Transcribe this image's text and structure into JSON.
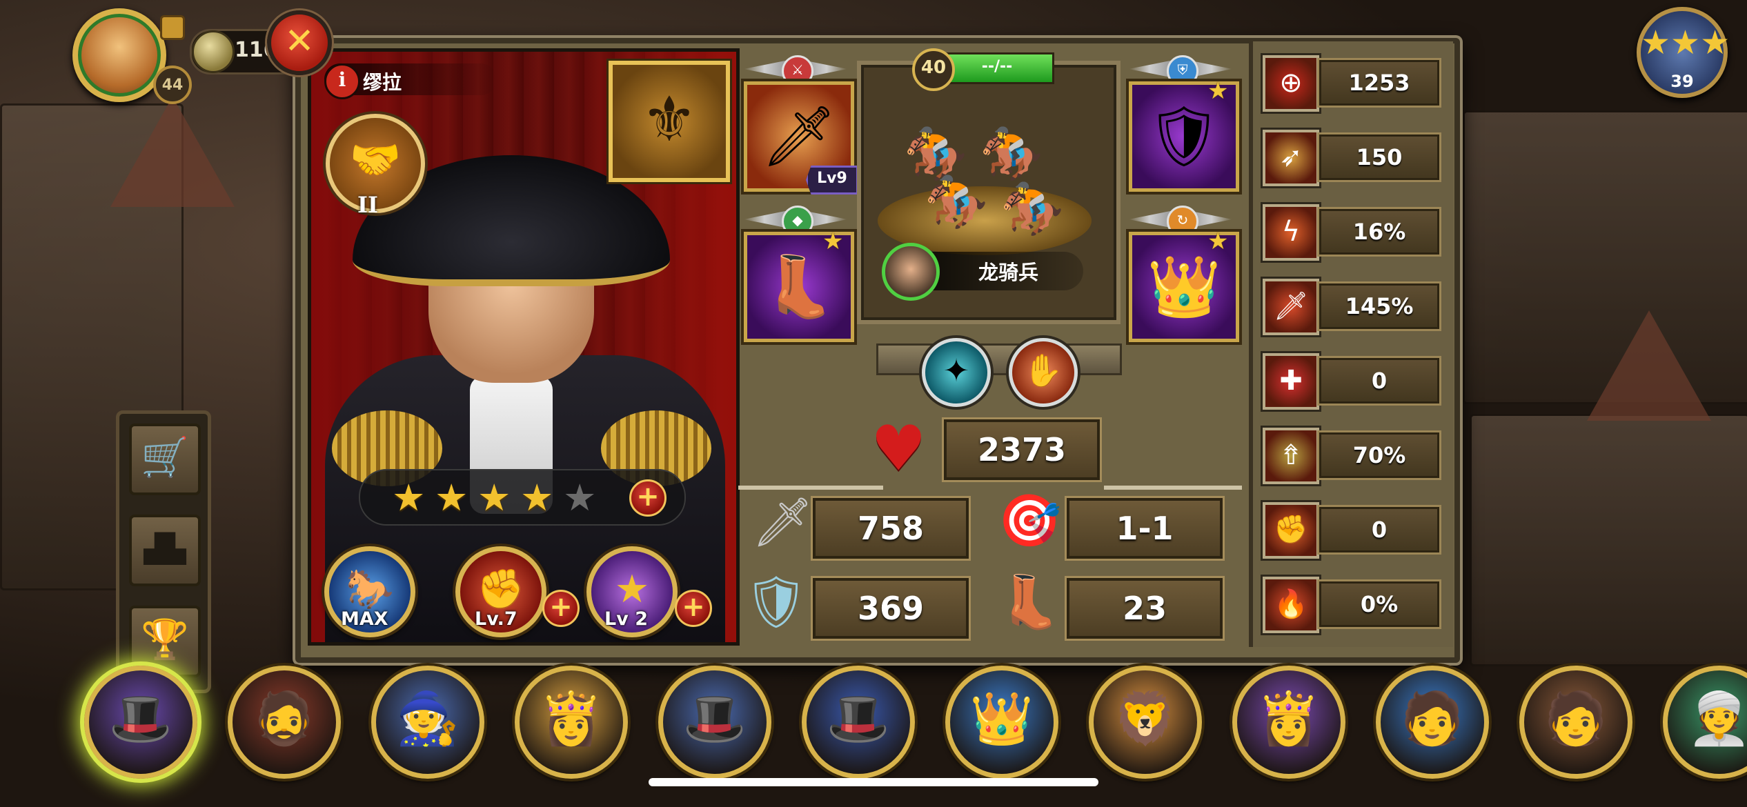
{
  "hud": {
    "player_level": "44",
    "coins": "116",
    "close_label": "✕",
    "rank_stars": "★★★",
    "rank_level": "39"
  },
  "hero": {
    "name": "缪拉",
    "info_icon": "i",
    "rank_roman": "II",
    "stars_filled": 4,
    "stars_total": 5,
    "skills": [
      {
        "name": "horse-skill",
        "label": "MAX"
      },
      {
        "name": "fist-skill",
        "label": "Lv.7"
      },
      {
        "name": "star-skill",
        "label": "Lv 2"
      }
    ]
  },
  "equipment": {
    "weapon_level": "Lv9"
  },
  "troop": {
    "level": "40",
    "bar_text": "--/--",
    "name": "龙骑兵"
  },
  "stats": {
    "hp": "2373",
    "attack": "758",
    "range": "1-1",
    "defense": "369",
    "speed": "23"
  },
  "right_stats": [
    {
      "icon": "target-icon",
      "value": "1253"
    },
    {
      "icon": "dodge-icon",
      "value": "150"
    },
    {
      "icon": "crit-chance-icon",
      "value": "16%"
    },
    {
      "icon": "crit-damage-icon",
      "value": "145%"
    },
    {
      "icon": "heal-icon",
      "value": "0"
    },
    {
      "icon": "rank-up-icon",
      "value": "70%"
    },
    {
      "icon": "fist-power-icon",
      "value": "0"
    },
    {
      "icon": "burn-icon",
      "value": "0%"
    }
  ],
  "hero_list": [
    {
      "name": "murat"
    },
    {
      "name": "hero-bearded-warrior"
    },
    {
      "name": "hero-old-sage"
    },
    {
      "name": "hero-blonde-queen"
    },
    {
      "name": "hero-bicorne-officer"
    },
    {
      "name": "hero-napoleon"
    },
    {
      "name": "hero-cleopatra"
    },
    {
      "name": "hero-blonde-general"
    },
    {
      "name": "hero-eastern-queen"
    },
    {
      "name": "hero-headband-warrior"
    },
    {
      "name": "hero-long-hair-warrior"
    },
    {
      "name": "hero-green-turban"
    }
  ],
  "colors": {
    "panel": "#6e6344",
    "gold_border": "#d8b451",
    "curtain_red": "#b02218",
    "hp_red": "#d41c1c",
    "troop_bar_green": "#2fb82a"
  }
}
